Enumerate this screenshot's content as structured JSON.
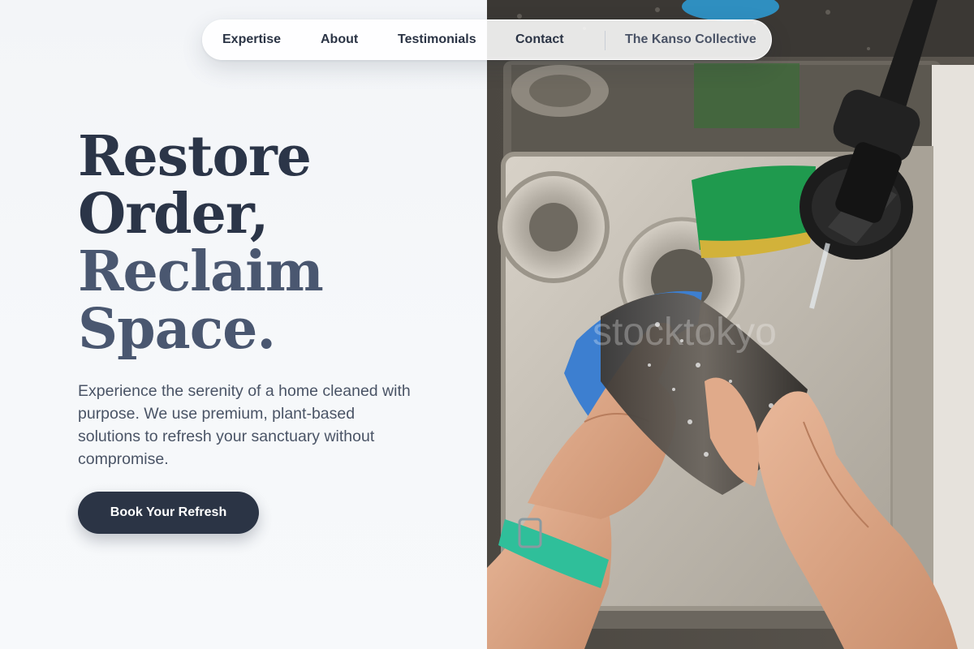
{
  "nav": {
    "items": [
      {
        "label": "Expertise"
      },
      {
        "label": "About"
      },
      {
        "label": "Testimonials"
      },
      {
        "label": "Contact"
      }
    ],
    "brand": "The Kanso Collective"
  },
  "hero": {
    "headline_lines": [
      "Restore",
      "Order,",
      "Reclaim",
      "Space."
    ],
    "description": "Experience the serenity of a home cleaned with purpose. We use premium, plant-based solutions to refresh your sanctuary without compromise.",
    "cta_label": "Book Your Refresh"
  },
  "photo": {
    "watermark": "stocktokyo"
  },
  "colors": {
    "primary": "#2b3445",
    "headline_secondary": "#4a5770",
    "background": "#f6f8fa",
    "watch_strap": "#2fbf9a",
    "sponge_green": "#1f9a4e",
    "sponge_blue": "#3d7fd0"
  }
}
